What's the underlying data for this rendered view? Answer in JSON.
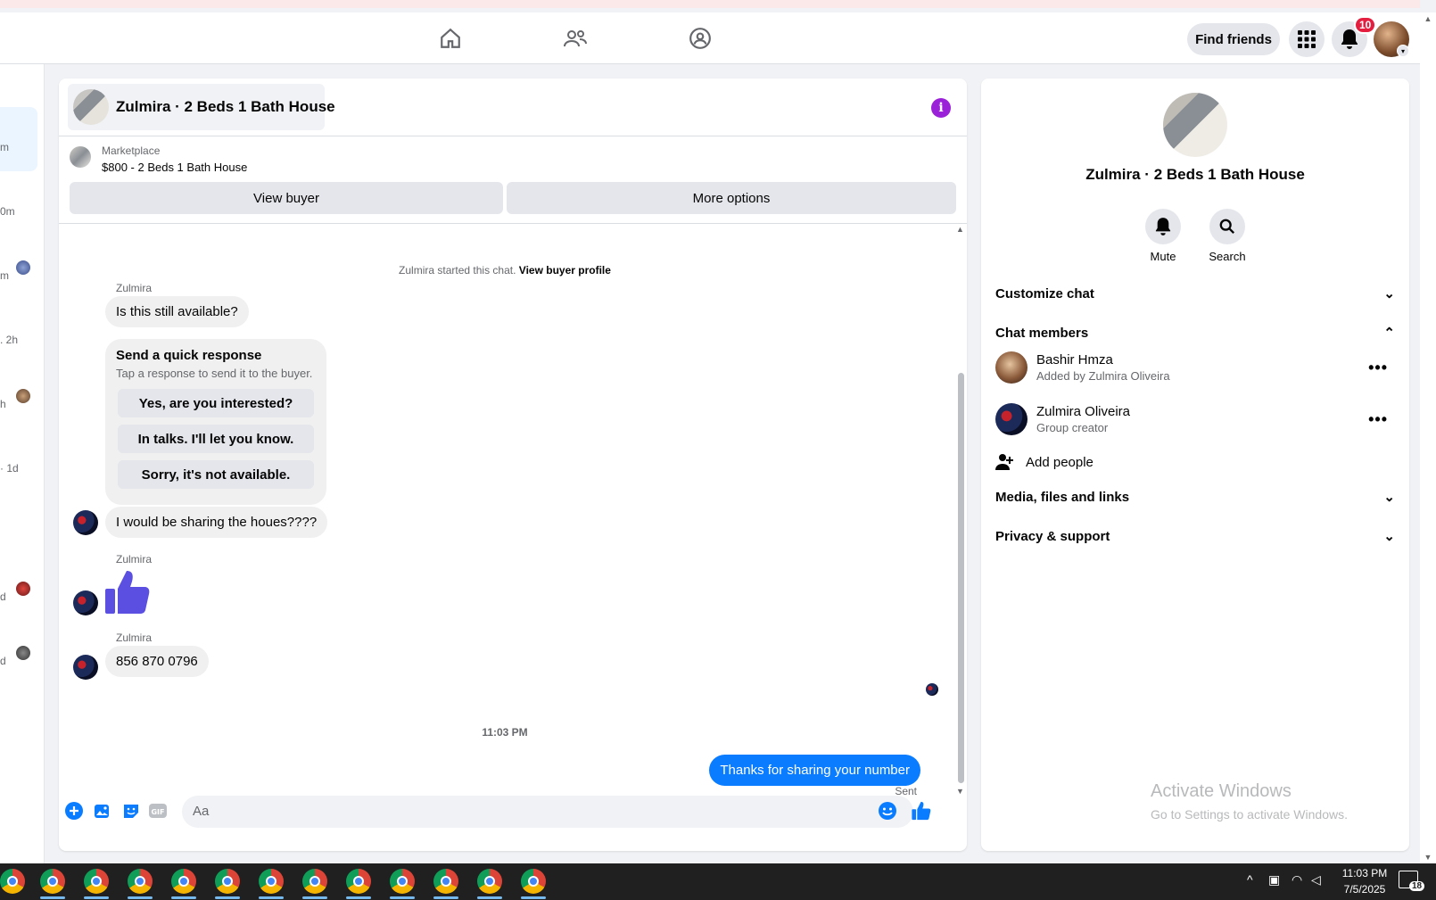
{
  "topbar": {
    "find_friends": "Find friends",
    "notification_count": "10"
  },
  "left_list": {
    "times": [
      "m",
      "0m",
      "m",
      ". 2h",
      "h",
      "· 1d",
      "d",
      "d"
    ]
  },
  "chat": {
    "header_title": "Zulmira · 2 Beds 1 Bath House",
    "marketplace_label": "Marketplace",
    "listing": "$800 - 2 Beds 1 Bath House",
    "view_buyer": "View buyer",
    "more_options": "More options",
    "system_text": "Zulmira started this chat.",
    "system_link": "View buyer profile",
    "sender1": "Zulmira",
    "msg1": "Is this still available?",
    "quick_title": "Send a quick response",
    "quick_sub": "Tap a response to send it to the buyer.",
    "quick_options": [
      "Yes, are you interested?",
      "In talks. I'll let you know.",
      "Sorry, it's not available."
    ],
    "msg2": "I would be sharing the houes????",
    "sender2": "Zulmira",
    "sender3": "Zulmira",
    "msg3": "856 870 0796",
    "timestamp": "11:03 PM",
    "my_msg": "Thanks for sharing your number",
    "sent": "Sent",
    "input_placeholder": "Aa"
  },
  "info": {
    "title": "Zulmira · 2 Beds 1 Bath House",
    "mute": "Mute",
    "search": "Search",
    "customize": "Customize chat",
    "members_title": "Chat members",
    "members": [
      {
        "name": "Bashir Hmza",
        "sub": "Added by Zulmira Oliveira"
      },
      {
        "name": "Zulmira Oliveira",
        "sub": "Group creator"
      }
    ],
    "add_people": "Add people",
    "media": "Media, files and links",
    "privacy": "Privacy & support"
  },
  "watermark": {
    "line1": "Activate Windows",
    "line2": "Go to Settings to activate Windows."
  },
  "taskbar": {
    "time": "11:03 PM",
    "date": "7/5/2025",
    "notif": "18"
  },
  "colors": {
    "accent": "#0a7cff",
    "info": "#9b21d8",
    "badge": "#e41e3f"
  }
}
